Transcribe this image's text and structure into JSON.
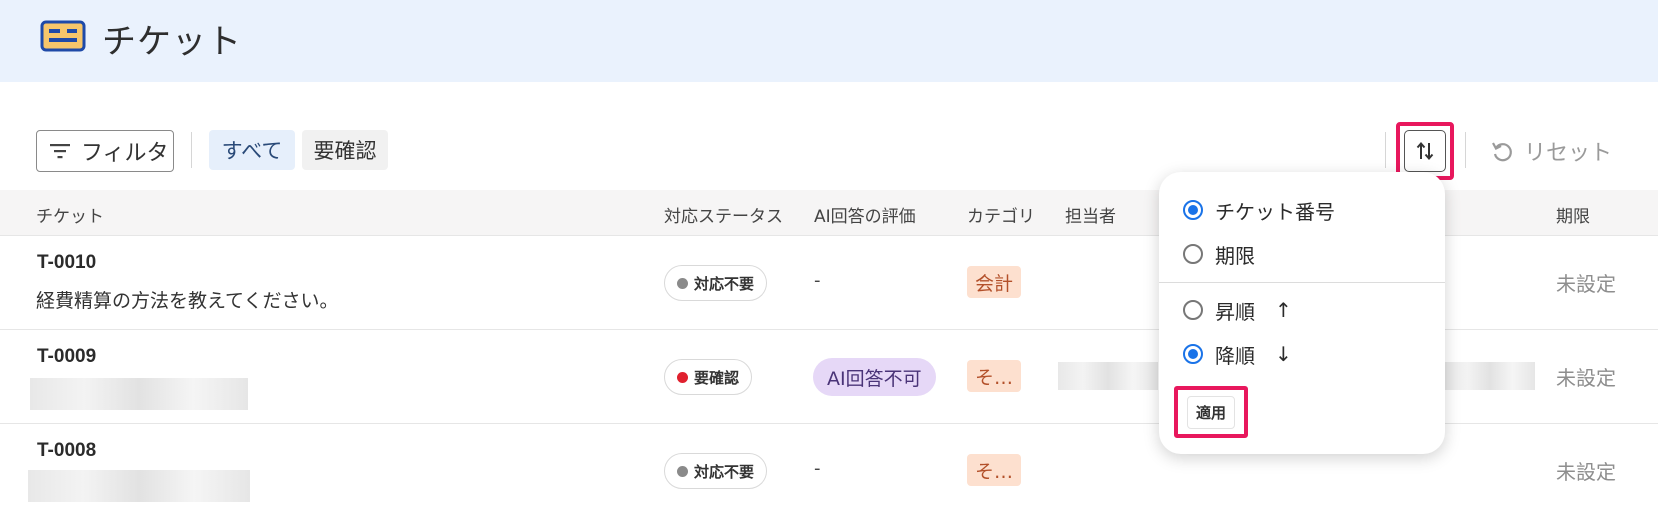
{
  "header": {
    "title": "チケット"
  },
  "toolbar": {
    "filter_label": "フィルタ",
    "chips": [
      "すべて",
      "要確認"
    ],
    "reset_label": "リセット"
  },
  "table": {
    "columns": [
      "チケット",
      "対応ステータス",
      "AI回答の評価",
      "カテゴリ",
      "担当者",
      "期限"
    ],
    "rows": [
      {
        "id": "T-0010",
        "subject": "経費精算の方法を教えてください。",
        "status": "対応不要",
        "status_color": "#8a8a8a",
        "ai_eval": "-",
        "category": "会計",
        "due": "未設定"
      },
      {
        "id": "T-0009",
        "subject": "",
        "status": "要確認",
        "status_color": "#e0202e",
        "ai_eval": "AI回答不可",
        "category": "そ…",
        "due": "未設定"
      },
      {
        "id": "T-0008",
        "subject": "",
        "status": "対応不要",
        "status_color": "#8a8a8a",
        "ai_eval": "-",
        "category": "そ…",
        "due": "未設定"
      }
    ]
  },
  "sort_popup": {
    "fields": [
      {
        "label": "チケット番号",
        "selected": true
      },
      {
        "label": "期限",
        "selected": false
      }
    ],
    "orders": [
      {
        "label": "昇順",
        "arrow": "↑",
        "selected": false
      },
      {
        "label": "降順",
        "arrow": "↓",
        "selected": true
      }
    ],
    "apply_label": "適用"
  },
  "colors": {
    "header_bg": "#eaf2fd",
    "accent": "#1a73e8",
    "highlight": "#e8175d"
  },
  "icons": [
    "ticket-icon",
    "filter-icon",
    "sort-icon",
    "reset-icon"
  ]
}
